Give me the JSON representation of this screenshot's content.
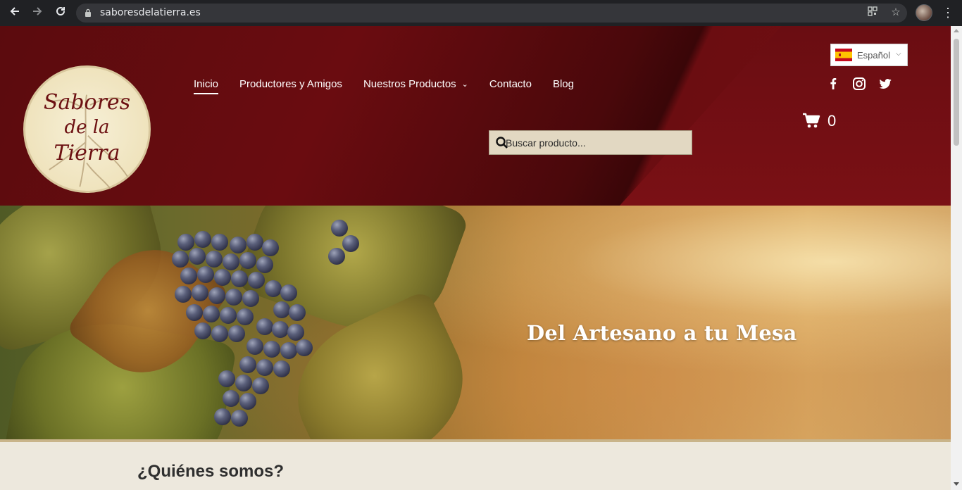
{
  "browser": {
    "url": "saboresdelatierra.es",
    "icons": [
      "back-icon",
      "forward-icon",
      "reload-icon",
      "lock-icon",
      "qr-icon",
      "star-icon",
      "profile-avatar",
      "menu-kebab-icon"
    ]
  },
  "header": {
    "logo": {
      "line1": "Sabores",
      "line2": "de la",
      "line3": "Tierra"
    },
    "nav": [
      {
        "label": "Inicio",
        "active": true
      },
      {
        "label": "Productores y Amigos"
      },
      {
        "label": "Nuestros Productos",
        "has_dropdown": true
      },
      {
        "label": "Contacto"
      },
      {
        "label": "Blog"
      }
    ],
    "search": {
      "placeholder": "Buscar producto..."
    },
    "language": {
      "selected": "Español",
      "flag": "spain-flag-icon"
    },
    "social": [
      "facebook-icon",
      "instagram-icon",
      "twitter-icon"
    ],
    "cart": {
      "count": "0"
    }
  },
  "hero": {
    "title": "Del Artesano a tu Mesa"
  },
  "about": {
    "title": "¿Quiénes somos?"
  },
  "colors": {
    "header_bg": "#6a0c10",
    "search_bg": "#e2d8c2",
    "page_bg": "#ede8dd",
    "accent_gold": "#c9b48a"
  }
}
